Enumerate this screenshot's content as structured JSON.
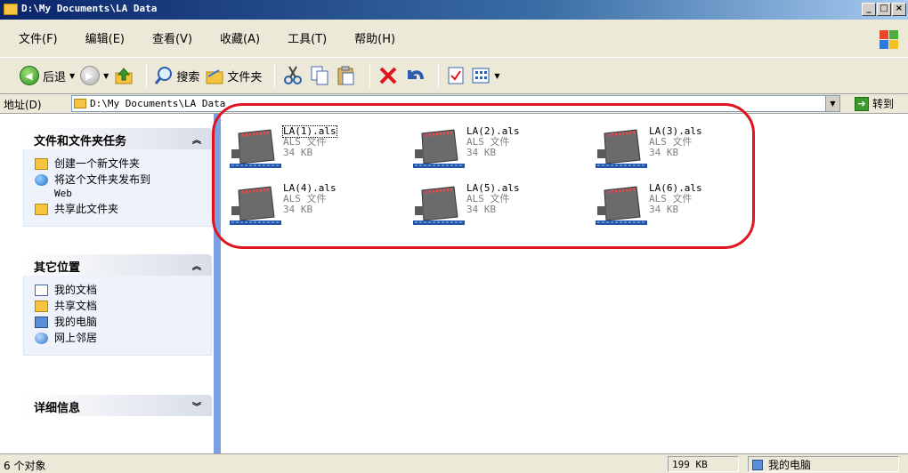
{
  "window": {
    "title": "D:\\My Documents\\LA Data",
    "buttons": {
      "minimize": "_",
      "maximize": "□",
      "close": "×"
    }
  },
  "menu": [
    "文件(F)",
    "编辑(E)",
    "查看(V)",
    "收藏(A)",
    "工具(T)",
    "帮助(H)"
  ],
  "toolbar": {
    "back_label": "后退",
    "search_label": "搜索",
    "folders_label": "文件夹"
  },
  "address": {
    "label": "地址(D)",
    "value": "D:\\My Documents\\LA Data",
    "go_label": "转到"
  },
  "tasks_panel": {
    "title": "文件和文件夹任务",
    "items": [
      "创建一个新文件夹",
      "将这个文件夹发布到",
      "Web",
      "共享此文件夹"
    ]
  },
  "places_panel": {
    "title": "其它位置",
    "items": [
      "我的文档",
      "共享文档",
      "我的电脑",
      "网上邻居"
    ]
  },
  "details_panel": {
    "title": "详细信息"
  },
  "files": [
    {
      "name": "LA(1).als",
      "type": "ALS 文件",
      "size": "34 KB"
    },
    {
      "name": "LA(2).als",
      "type": "ALS 文件",
      "size": "34 KB"
    },
    {
      "name": "LA(3).als",
      "type": "ALS 文件",
      "size": "34 KB"
    },
    {
      "name": "LA(4).als",
      "type": "ALS 文件",
      "size": "34 KB"
    },
    {
      "name": "LA(5).als",
      "type": "ALS 文件",
      "size": "34 KB"
    },
    {
      "name": "LA(6).als",
      "type": "ALS 文件",
      "size": "34 KB"
    }
  ],
  "status": {
    "objects": "6 个对象",
    "size": "199 KB",
    "location": "我的电脑"
  },
  "colors": {
    "highlight": "#e0141e",
    "titlebar": "#0a246a"
  }
}
